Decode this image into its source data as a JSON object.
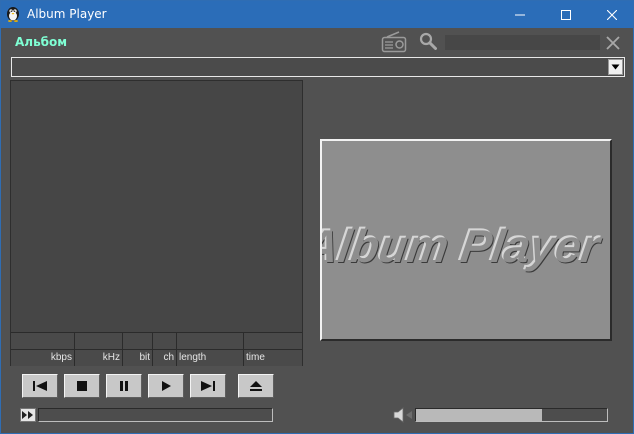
{
  "window": {
    "title": "Album Player",
    "icon": "penguin-app-icon",
    "controls": [
      "minimize-icon",
      "maximize-icon",
      "close-icon"
    ]
  },
  "toolbar": {
    "album_label": "Альбом",
    "radio_icon": "radio-icon",
    "search_icon": "search-icon",
    "search_value": "",
    "clear_icon": "close-icon"
  },
  "album_select": {
    "value": "",
    "dropdown_icon": "chevron-down-icon"
  },
  "track_info": {
    "row1": [
      "",
      "",
      "",
      "",
      "",
      ""
    ],
    "row2": [
      "kbps",
      "kHz",
      "bit",
      "ch",
      "length",
      "time"
    ]
  },
  "album_art": {
    "logo_text": "Album Player"
  },
  "transport": {
    "buttons": [
      "previous-icon",
      "stop-icon",
      "pause-icon",
      "play-icon",
      "next-icon",
      "eject-icon"
    ]
  },
  "seek": {
    "progress": 0
  },
  "volume": {
    "level": 0.66
  },
  "colors": {
    "accent_label": "#7fffd4",
    "titlebar": "#2b6db8",
    "background": "#515151"
  }
}
